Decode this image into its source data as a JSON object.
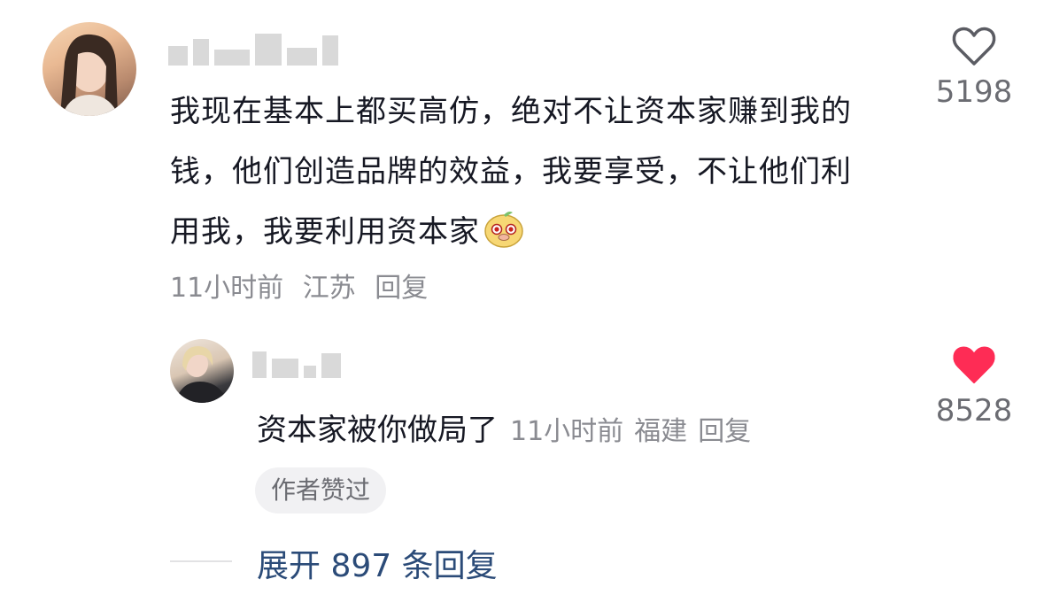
{
  "comment": {
    "text": "我现在基本上都买高仿，绝对不让资本家赚到我的钱，他们创造品牌的效益，我要享受，不让他们利用我，我要利用资本家",
    "time": "11小时前",
    "location": "江苏",
    "reply_label": "回复",
    "like_count": "5198",
    "like_state": "not-liked"
  },
  "reply": {
    "text": "资本家被你做局了",
    "time": "11小时前",
    "location": "福建",
    "reply_label": "回复",
    "like_count": "8528",
    "like_state": "liked",
    "badge": "作者赞过"
  },
  "expand_label": "展开 897 条回复",
  "colors": {
    "heart_liked": "#fe2c55",
    "heart_outline": "#5b5c63",
    "link": "#2b4b78",
    "meta": "#8a8b91"
  }
}
